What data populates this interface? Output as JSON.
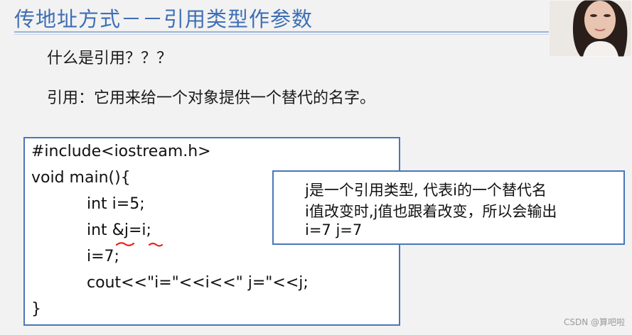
{
  "slide": {
    "title": "传地址方式－－引用类型作参数",
    "question": "什么是引用？？？",
    "definition": "引用：它用来给一个对象提供一个替代的名字。"
  },
  "code": {
    "lines": [
      "#include<iostream.h>",
      "void main(){",
      "int i=5;",
      "int &j=i;",
      "i=7;",
      "cout<<\"i=\"<<i<<\" j=\"<<j;",
      "}"
    ]
  },
  "note": {
    "lines": [
      "j是一个引用类型, 代表i的一个替代名",
      "i值改变时,j值也跟着改变，所以会输出",
      "i=7 j=7"
    ]
  },
  "watermark": "CSDN @算吧啦",
  "colors": {
    "title": "#3f6fb5",
    "box_border": "#4a76b8",
    "annotation": "#e8261c",
    "background": "#f2f2f2"
  }
}
